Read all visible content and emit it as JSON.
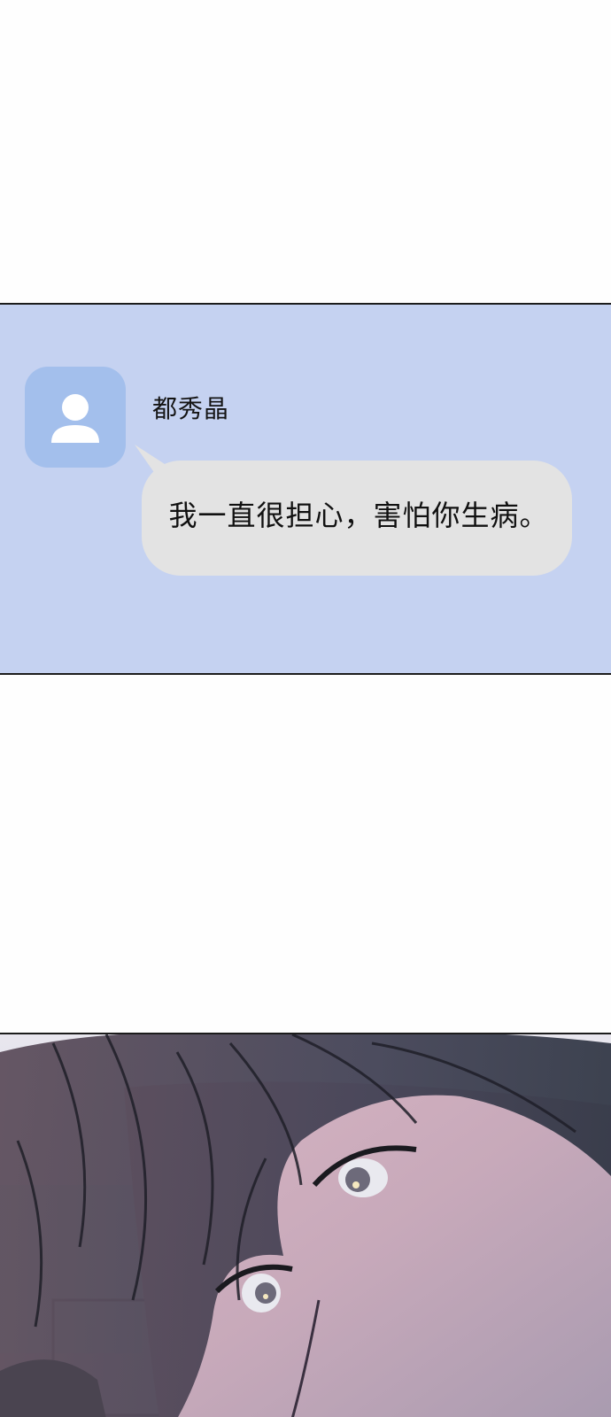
{
  "message": {
    "sender_name": "都秀晶",
    "text": "我一直很担心，害怕你生病。",
    "avatar_icon": "person-icon"
  },
  "colors": {
    "panel_bg": "#c5d2f1",
    "avatar_bg": "#a3bfec",
    "bubble_bg": "#e3e3e3"
  },
  "illustration": {
    "subject": "close-up-face-with-dark-hair"
  }
}
